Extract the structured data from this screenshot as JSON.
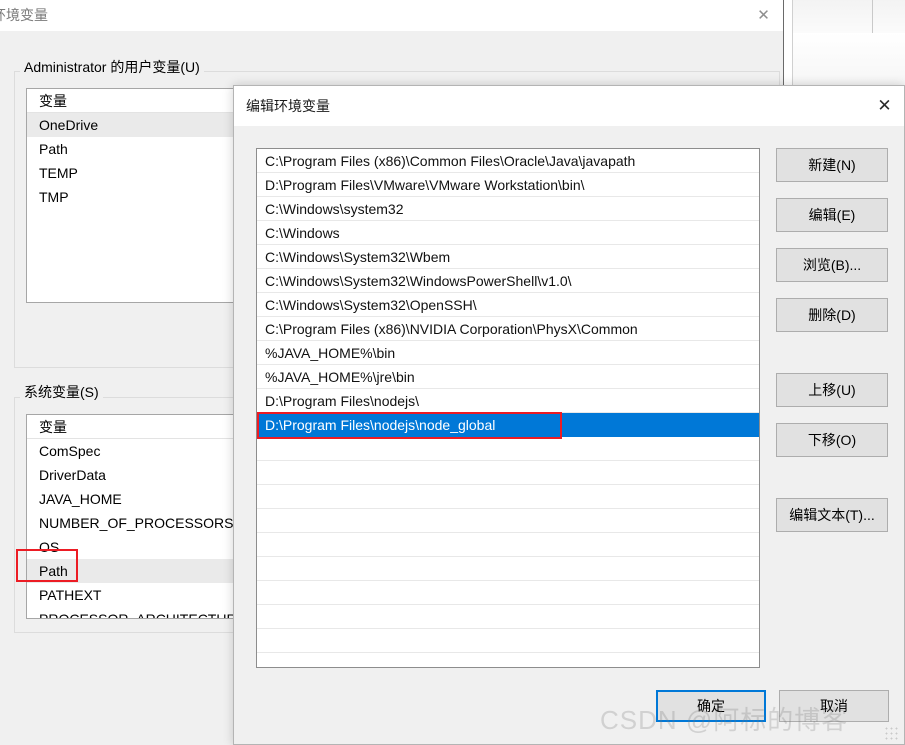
{
  "background_window": {
    "title": "环境变量",
    "close_icon": "close-icon",
    "user_group_label": "Administrator 的用户变量(U)",
    "user_vars": {
      "column_header": "变量",
      "rows": [
        "OneDrive",
        "Path",
        "TEMP",
        "TMP"
      ],
      "selected_row": "OneDrive"
    },
    "system_group_label": "系统变量(S)",
    "system_vars": {
      "column_header": "变量",
      "rows": [
        "ComSpec",
        "DriverData",
        "JAVA_HOME",
        "NUMBER_OF_PROCESSORS",
        "OS",
        "Path",
        "PATHEXT",
        "PROCESSOR_ARCHITECTURE"
      ],
      "selected_row": "Path",
      "annotation_target": "Path"
    }
  },
  "behind_window": {
    "chevron_icon": "chevron-down-icon"
  },
  "dialog": {
    "title": "编辑环境变量",
    "close_icon": "close-icon",
    "path_entries": [
      "C:\\Program Files (x86)\\Common Files\\Oracle\\Java\\javapath",
      "D:\\Program Files\\VMware\\VMware Workstation\\bin\\",
      "C:\\Windows\\system32",
      "C:\\Windows",
      "C:\\Windows\\System32\\Wbem",
      "C:\\Windows\\System32\\WindowsPowerShell\\v1.0\\",
      "C:\\Windows\\System32\\OpenSSH\\",
      "C:\\Program Files (x86)\\NVIDIA Corporation\\PhysX\\Common",
      "%JAVA_HOME%\\bin",
      "%JAVA_HOME%\\jre\\bin",
      "D:\\Program Files\\nodejs\\",
      "D:\\Program Files\\nodejs\\node_global"
    ],
    "selected_entry_index": 11,
    "selected_entry": "D:\\Program Files\\nodejs\\node_global",
    "blank_rows": 10,
    "side_buttons": [
      {
        "label": "新建(N)",
        "name": "new-button"
      },
      {
        "label": "编辑(E)",
        "name": "edit-button"
      },
      {
        "label": "浏览(B)...",
        "name": "browse-button"
      },
      {
        "label": "删除(D)",
        "name": "delete-button"
      },
      {
        "label": "上移(U)",
        "name": "move-up-button"
      },
      {
        "label": "下移(O)",
        "name": "move-down-button"
      },
      {
        "label": "编辑文本(T)...",
        "name": "edit-text-button"
      }
    ],
    "ok_label": "确定",
    "cancel_label": "取消"
  },
  "watermark": {
    "text": "CSDN @阿标的博客"
  },
  "colors": {
    "selection_blue": "#0078d7",
    "annotation_red": "#ec1c24",
    "dialog_face": "#f0f0f0",
    "button_face": "#e1e1e1"
  }
}
